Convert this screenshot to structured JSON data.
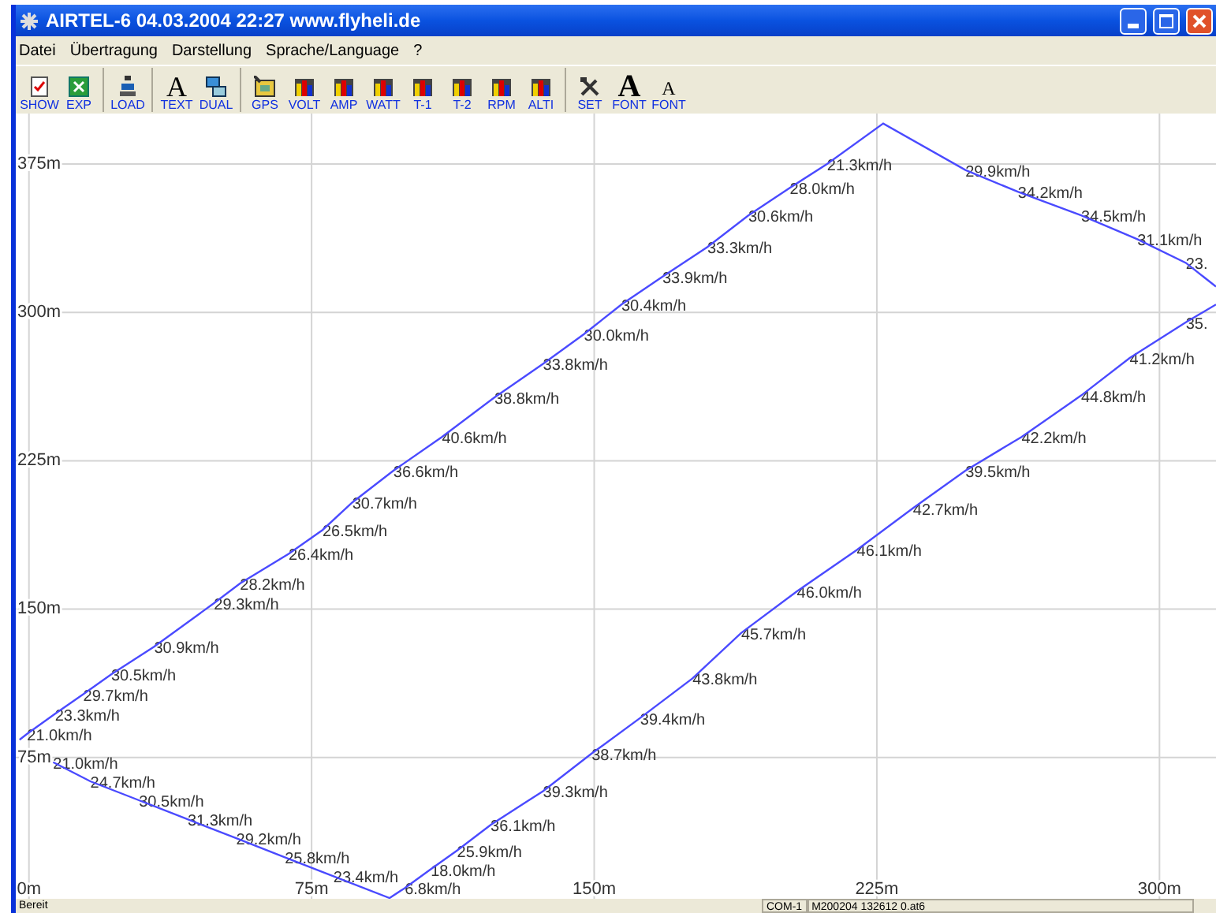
{
  "window": {
    "title": "AIRTEL-6 04.03.2004 22:27 www.flyheli.de"
  },
  "menu": [
    "Datei",
    "Übertragung",
    "Darstellung",
    "Sprache/Language",
    "?"
  ],
  "toolbar": [
    [
      {
        "label": "SHOW",
        "kind": "checklist"
      },
      {
        "label": "EXP",
        "kind": "sheet"
      }
    ],
    [
      {
        "label": "LOAD",
        "kind": "load"
      }
    ],
    [
      {
        "label": "TEXT",
        "kind": "letter",
        "glyph": "A"
      },
      {
        "label": "DUAL",
        "kind": "dual"
      }
    ],
    [
      {
        "label": "GPS",
        "kind": "gps"
      },
      {
        "label": "VOLT",
        "kind": "bars"
      },
      {
        "label": "AMP",
        "kind": "bars"
      },
      {
        "label": "WATT",
        "kind": "bars"
      },
      {
        "label": "T-1",
        "kind": "bars"
      },
      {
        "label": "T-2",
        "kind": "bars"
      },
      {
        "label": "RPM",
        "kind": "bars"
      },
      {
        "label": "ALTI",
        "kind": "bars"
      }
    ],
    [
      {
        "label": "SET",
        "kind": "tools"
      },
      {
        "label": "FONT",
        "kind": "letter-big",
        "glyph": "A"
      },
      {
        "label": "FONT",
        "kind": "letter-small",
        "glyph": "A"
      }
    ]
  ],
  "plot": {
    "chart_data": {
      "type": "line",
      "grid": true,
      "xlim": [
        -3.5,
        315
      ],
      "ylim": [
        3.6,
        400.5
      ],
      "xticks": [
        {
          "value": 0,
          "label": "0m"
        },
        {
          "value": 75,
          "label": "75m"
        },
        {
          "value": 150,
          "label": "150m"
        },
        {
          "value": 225,
          "label": "225m"
        },
        {
          "value": 300,
          "label": "300m"
        }
      ],
      "yticks": [
        {
          "value": 75,
          "label": "75m"
        },
        {
          "value": 150,
          "label": "150m"
        },
        {
          "value": 225,
          "label": "225m"
        },
        {
          "value": 300,
          "label": "300m"
        },
        {
          "value": 375,
          "label": "375m"
        }
      ],
      "x": [
        -2.5,
        -0.5,
        6.9,
        14.4,
        21.8,
        33.2,
        49.1,
        56,
        68.9,
        77.9,
        85.8,
        96.7,
        109.6,
        123.5,
        136.4,
        147.3,
        157.2,
        168.1,
        180,
        190.9,
        201.9,
        211.8,
        226.7,
        248.5,
        262.4,
        279.2,
        294.1,
        307,
        315,
        null,
        315,
        307,
        292.1,
        279.2,
        263.4,
        248.5,
        234.6,
        219.7,
        203.8,
        189,
        176.1,
        162.2,
        149.3,
        136.4,
        122.5,
        113.6,
        106.6,
        99.7,
        95.7,
        80.8,
        67.9,
        55,
        42.1,
        29.2,
        16.3,
        6.4,
        null
      ],
      "series": [
        {
          "color": "#4a4aff",
          "values": [
            84,
            87,
            97,
            107,
            117,
            131,
            153,
            163,
            178,
            190,
            204,
            220,
            237,
            257,
            274,
            289,
            304,
            318,
            333,
            349,
            363,
            375,
            395.5,
            372,
            361,
            349,
            337,
            325,
            313,
            null,
            304,
            295,
            277,
            258,
            237,
            220,
            201,
            180,
            159,
            138,
            115,
            95,
            77,
            58,
            41,
            28,
            18.5,
            9,
            4,
            15,
            24.6,
            34.2,
            43.8,
            53.4,
            63,
            72.6,
            null
          ]
        }
      ],
      "value_labels": [
        null,
        "21.0km/h",
        "23.3km/h",
        "29.7km/h",
        "30.5km/h",
        "30.9km/h",
        "29.3km/h",
        "28.2km/h",
        "26.4km/h",
        "26.5km/h",
        "30.7km/h",
        "36.6km/h",
        "40.6km/h",
        "38.8km/h",
        "33.8km/h",
        "30.0km/h",
        "30.4km/h",
        "33.9km/h",
        "33.3km/h",
        "30.6km/h",
        "28.0km/h",
        "21.3km/h",
        null,
        "29.9km/h",
        "34.2km/h",
        "34.5km/h",
        "31.1km/h",
        "23.",
        null,
        null,
        null,
        "35.",
        "41.2km/h",
        "44.8km/h",
        "42.2km/h",
        "39.5km/h",
        "42.7km/h",
        "46.1km/h",
        "46.0km/h",
        "45.7km/h",
        "43.8km/h",
        "39.4km/h",
        "38.7km/h",
        "39.3km/h",
        "36.1km/h",
        "25.9km/h",
        "18.0km/h",
        "6.8km/h",
        null,
        "23.4km/h",
        "25.8km/h",
        "29.2km/h",
        "31.3km/h",
        "30.5km/h",
        "24.7km/h",
        "21.0km/h",
        null
      ]
    }
  },
  "status_bar": {
    "message": "Bereit",
    "panels": [
      "COM-1",
      "M200204 132612 0.at6"
    ]
  }
}
